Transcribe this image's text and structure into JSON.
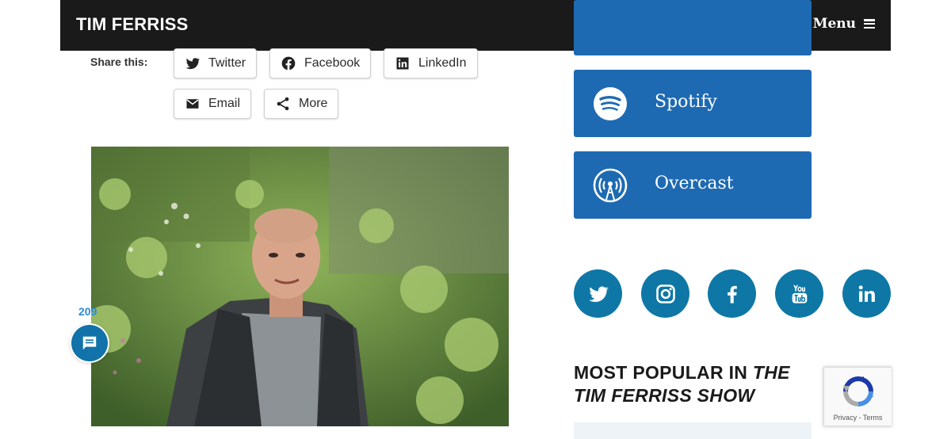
{
  "header": {
    "logo": "TIM FERRISS",
    "menu_label": "Menu"
  },
  "share": {
    "label": "Share this:",
    "buttons": [
      {
        "label": "Twitter",
        "icon": "twitter-icon"
      },
      {
        "label": "Facebook",
        "icon": "facebook-icon"
      },
      {
        "label": "LinkedIn",
        "icon": "linkedin-icon"
      },
      {
        "label": "Email",
        "icon": "email-icon"
      },
      {
        "label": "More",
        "icon": "share-icon"
      }
    ]
  },
  "comments": {
    "count": "209"
  },
  "subscribe": [
    {
      "label": "Spotify",
      "icon": "spotify-icon"
    },
    {
      "label": "Overcast",
      "icon": "overcast-icon"
    }
  ],
  "social": [
    "twitter-icon",
    "instagram-icon",
    "facebook-icon",
    "youtube-icon",
    "linkedin-icon"
  ],
  "sidebar": {
    "popular_prefix": "MOST POPULAR IN ",
    "popular_show": "THE TIM FERRISS SHOW"
  },
  "recaptcha": {
    "privacy": "Privacy",
    "terms": "Terms",
    "separator": " - "
  },
  "colors": {
    "header_bg": "#1a1a1a",
    "subscribe_bg": "#1e6ab2",
    "social_bg": "#0e77a6",
    "comment_bg": "#1173a9"
  }
}
